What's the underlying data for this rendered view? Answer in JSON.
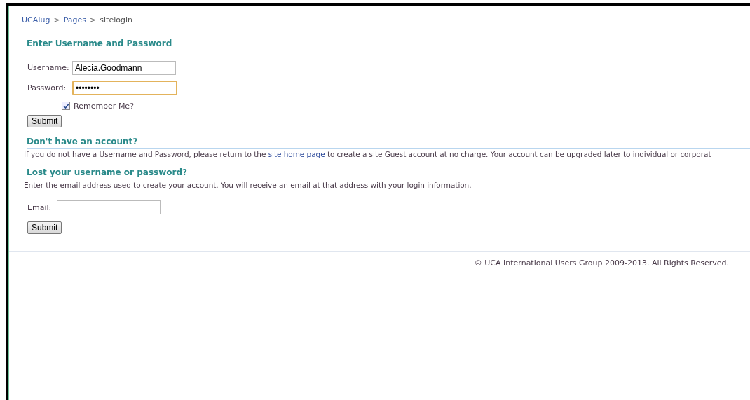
{
  "breadcrumb": [
    {
      "label": "UCAIug",
      "link": true
    },
    {
      "label": "Pages",
      "link": true
    },
    {
      "label": "sitelogin",
      "link": false
    }
  ],
  "breadcrumb_separator": ">",
  "login": {
    "heading": "Enter Username and Password",
    "username_label": "Username:",
    "username_value": "Alecia.Goodmann",
    "password_label": "Password:",
    "password_value": "••••••••",
    "password_focused": true,
    "remember_label": "Remember Me?",
    "remember_checked": true,
    "submit": "Submit"
  },
  "no_account": {
    "heading": "Don't have an account?",
    "text_before": "If you do not have a Username and Password, please return to the",
    "link": "site home page",
    "text_after": "to create a site Guest account at no charge. Your account can be upgraded later to individual or corporat"
  },
  "lost": {
    "heading": "Lost your username or password?",
    "text": "Enter the email address used to create your account. You will receive an email at that address with your login information.",
    "email_label": "Email:",
    "submit": "Submit"
  },
  "footer": "© UCA International Users Group 2009-2013. All Rights Reserved."
}
